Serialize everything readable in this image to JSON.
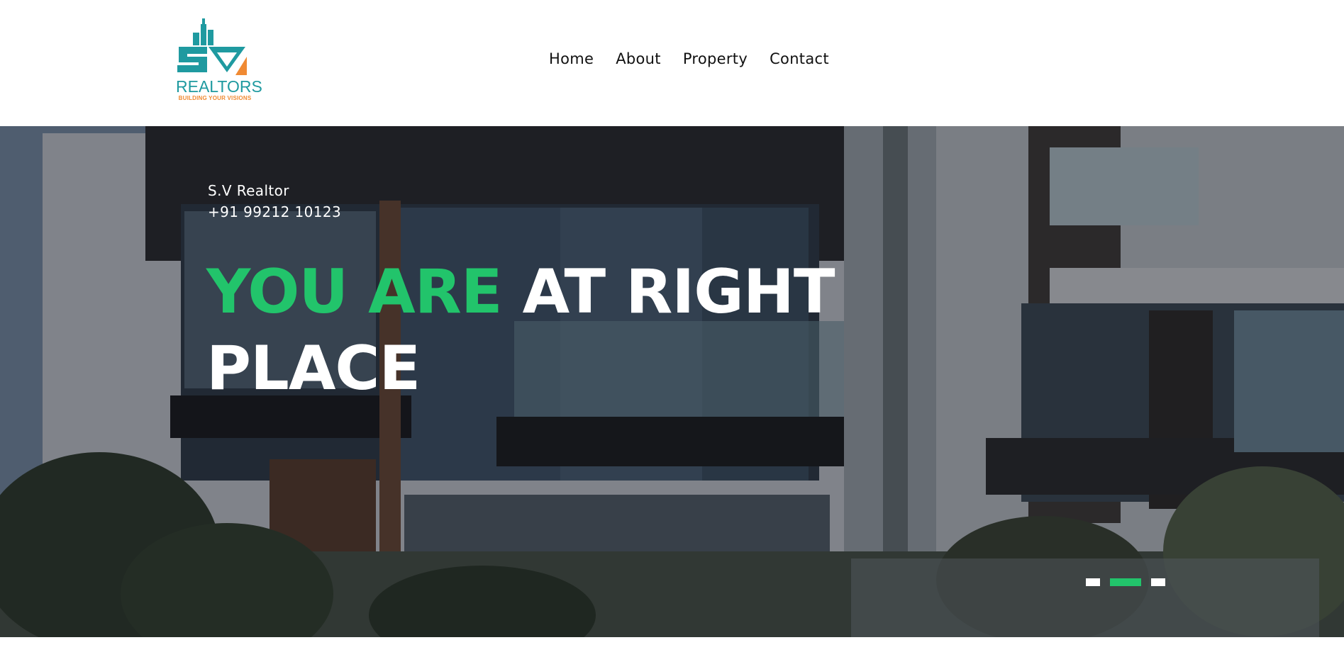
{
  "brand": {
    "logo_text": "REALTORS",
    "logo_tagline": "BUILDING YOUR VISIONS",
    "logo_letters": "SV",
    "colors": {
      "teal": "#1f9aa0",
      "orange": "#f08a33"
    }
  },
  "nav": {
    "items": [
      {
        "label": "Home"
      },
      {
        "label": "About"
      },
      {
        "label": "Property"
      },
      {
        "label": "Contact"
      }
    ]
  },
  "hero": {
    "company_name": "S.V Realtor",
    "phone": "+91 99212 10123",
    "headline_accent": "YOU ARE",
    "headline_rest": "AT RIGHT PLACE",
    "accent_color": "#22c46b",
    "background_image": "modern-building-photo",
    "slider": {
      "slide_count": 3,
      "active_index": 1
    }
  }
}
